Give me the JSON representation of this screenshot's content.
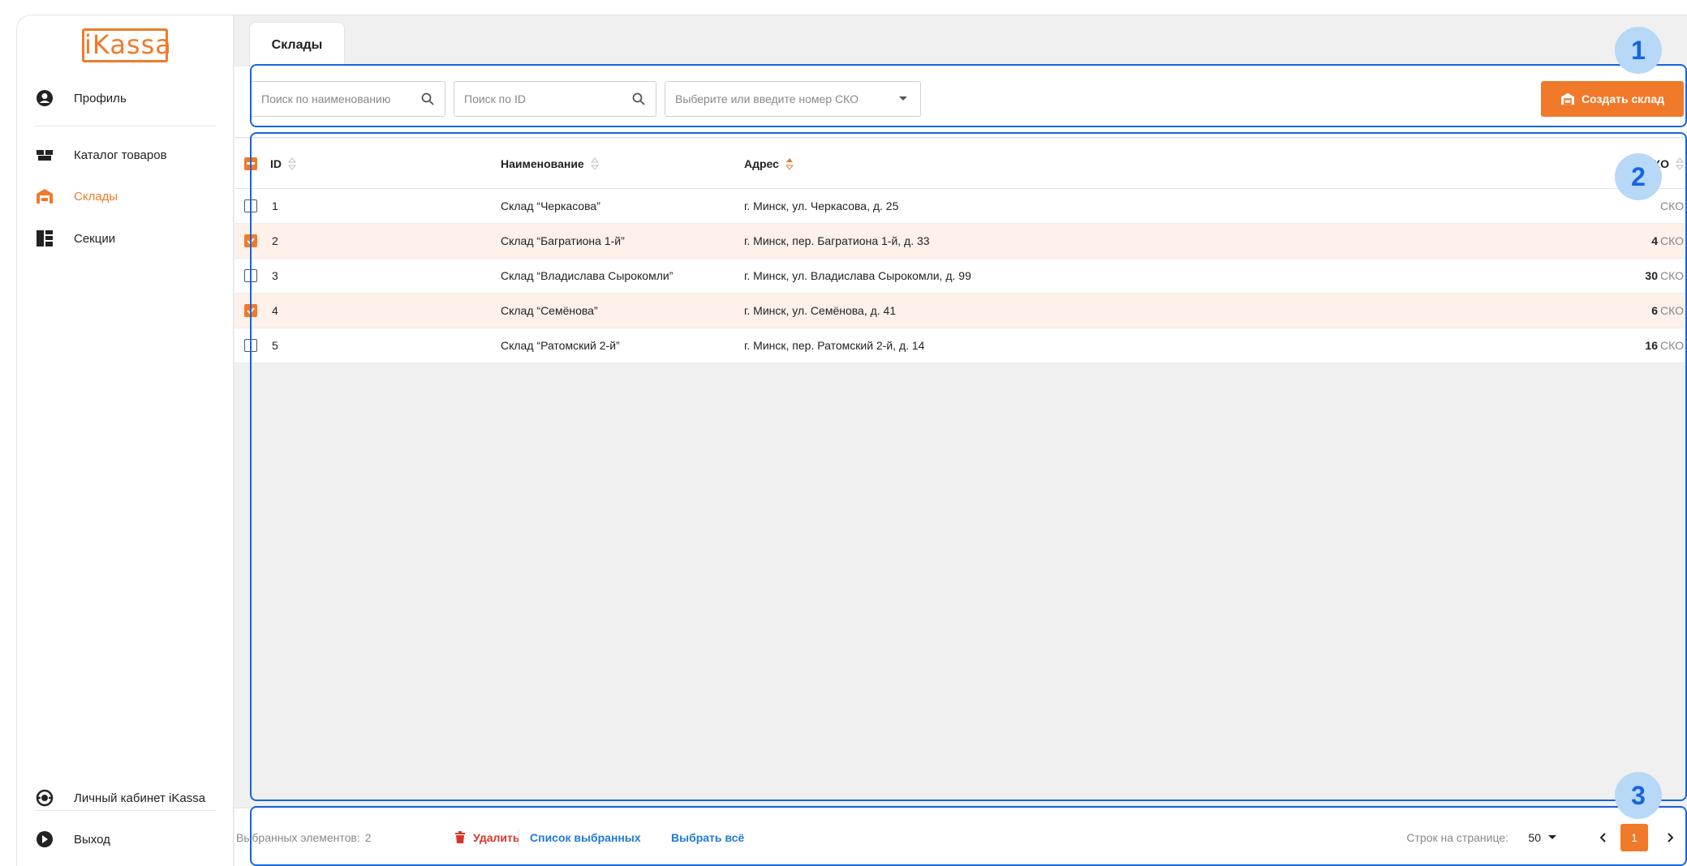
{
  "app": {
    "logo_text": "iKassa"
  },
  "sidebar": {
    "items": [
      {
        "label": "Профиль",
        "icon": "user-circle-icon"
      },
      {
        "label": "Каталог товаров",
        "icon": "boxes-icon"
      },
      {
        "label": "Склады",
        "icon": "warehouse-icon",
        "active": true
      },
      {
        "label": "Секции",
        "icon": "sections-icon"
      },
      {
        "label": "Личный кабинет iKassa",
        "icon": "cabinet-icon"
      },
      {
        "label": "Выход",
        "icon": "exit-icon"
      }
    ]
  },
  "tab": {
    "label": "Склады"
  },
  "toolbar": {
    "search_name_placeholder": "Поиск по наименованию",
    "search_id_placeholder": "Поиск по ID",
    "sko_select_placeholder": "Выберите или введите номер СКО",
    "create_button": "Создать склад"
  },
  "table": {
    "columns": {
      "id": "ID",
      "name": "Наименование",
      "address": "Адрес",
      "sko": "СКО"
    },
    "sko_unit": "СКО",
    "rows": [
      {
        "id": "1",
        "name": "Склад “Черкасова”",
        "address": "г. Минск, ул. Черкасова, д. 25",
        "sko": "",
        "selected": false
      },
      {
        "id": "2",
        "name": "Склад “Багратиона 1-й”",
        "address": "г. Минск, пер. Багратиона 1-й, д. 33",
        "sko": "4",
        "selected": true
      },
      {
        "id": "3",
        "name": "Склад “Владислава Сырокомли”",
        "address": "г. Минск, ул. Владислава Сырокомли, д. 99",
        "sko": "30",
        "selected": false
      },
      {
        "id": "4",
        "name": "Склад “Семёнова”",
        "address": "г. Минск, ул. Семёнова, д. 41",
        "sko": "6",
        "selected": true
      },
      {
        "id": "5",
        "name": "Склад “Ратомский 2-й”",
        "address": "г. Минск, пер. Ратомский 2-й, д. 14",
        "sko": "16",
        "selected": false
      }
    ]
  },
  "footer": {
    "selected_label": "Выбранных элементов:",
    "selected_count": "2",
    "delete_label": "Удалить",
    "selected_list_label": "Список выбранных",
    "select_all_label": "Выбрать всё",
    "rows_per_page_label": "Строк на странице:",
    "rows_per_page_value": "50",
    "current_page": "1"
  },
  "annotations": {
    "badge1": "1",
    "badge2": "2",
    "badge3": "3"
  },
  "colors": {
    "accent": "#f07a2a",
    "link": "#1f7ad6",
    "danger": "#d9342b",
    "highlight": "#1565e0"
  }
}
